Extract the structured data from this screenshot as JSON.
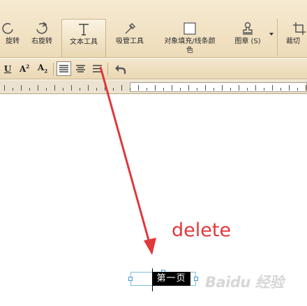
{
  "ribbon": {
    "tools": [
      {
        "label": "旋转",
        "icon": "rotate-left-icon"
      },
      {
        "label": "右旋转",
        "icon": "rotate-right-icon"
      },
      {
        "label": "文本工具",
        "icon": "text-tool-icon"
      },
      {
        "label": "吸管工具",
        "icon": "eyedropper-icon"
      },
      {
        "label": "对象填充/线条颜",
        "label_line2": "色",
        "icon": "fill-color-icon"
      },
      {
        "label": "图章 (S)",
        "icon": "stamp-icon"
      },
      {
        "label": "裁切",
        "icon": "crop-icon"
      }
    ],
    "active_tool": "文本工具"
  },
  "format_bar": {
    "underline_label": "U",
    "superscript_label": "A",
    "superscript_mark": "2",
    "subscript_label": "A",
    "subscript_mark": "2",
    "align_left_pressed": true
  },
  "document": {
    "selected_text": "第一页"
  },
  "annotation": {
    "text": "delete",
    "color": "#e0383b"
  },
  "watermark": {
    "text": "Baidu 经验"
  },
  "colors": {
    "ribbon_bg": "#f1e2c4",
    "selection_bg": "#000000",
    "textbox_border": "#7ec0dc",
    "arrow": "#e0383b"
  }
}
